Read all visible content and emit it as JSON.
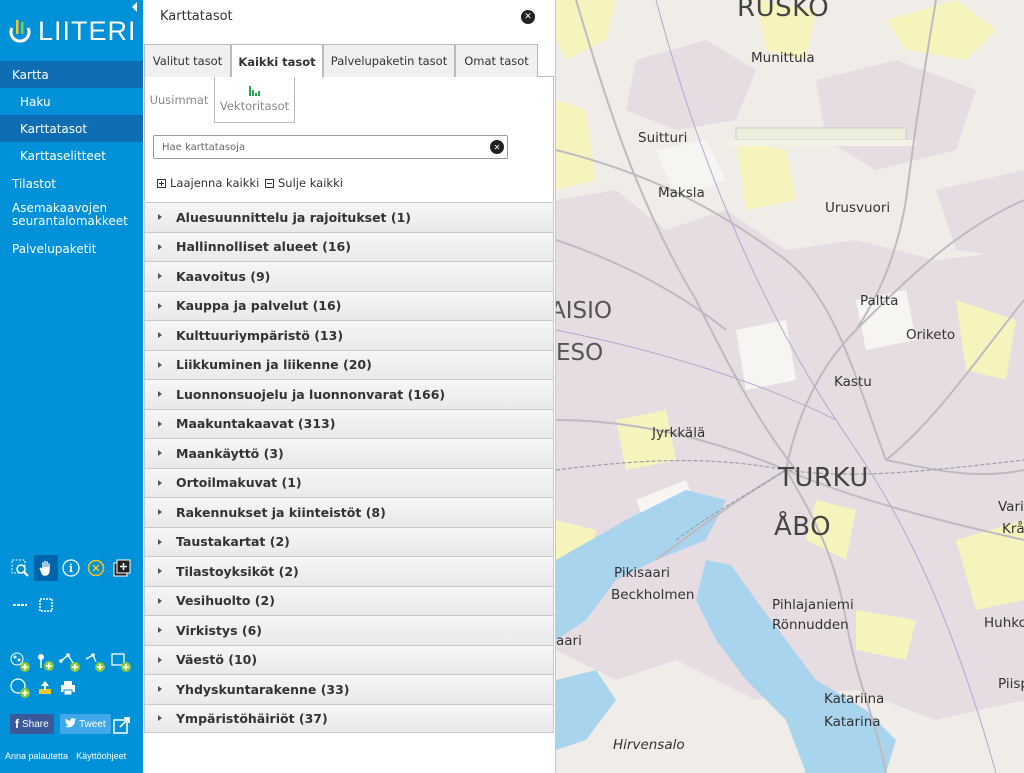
{
  "app": {
    "logo_text": "LIITERI"
  },
  "nav": {
    "kartta": "Kartta",
    "haku": "Haku",
    "karttatasot": "Karttatasot",
    "karttaselitteet": "Karttaselitteet",
    "tilastot": "Tilastot",
    "asemakaavojen": "Asemakaavojen seurantalomakkeet",
    "palvelupaketit": "Palvelupaketit"
  },
  "share": {
    "facebook": "Share",
    "twitter": "Tweet"
  },
  "footer": {
    "feedback": "Anna palautetta",
    "help": "Käyttöohjeet"
  },
  "panel": {
    "title": "Karttatasot",
    "tabs": [
      "Valitut tasot",
      "Kaikki tasot",
      "Palvelupaketin tasot",
      "Omat tasot"
    ],
    "subtabs": [
      "Uusimmat",
      "Vektoritasot"
    ],
    "search_placeholder": "Hae karttatasoja",
    "expand_all": "Laajenna kaikki",
    "collapse_all": "Sulje kaikki",
    "groups": [
      "Aluesuunnittelu ja rajoitukset (1)",
      "Hallinnolliset alueet (16)",
      "Kaavoitus (9)",
      "Kauppa ja palvelut (16)",
      "Kulttuuriympäristö (13)",
      "Liikkuminen ja liikenne (20)",
      "Luonnonsuojelu ja luonnonvarat (166)",
      "Maakuntakaavat (313)",
      "Maankäyttö (3)",
      "Ortoilmakuvat (1)",
      "Rakennukset ja kiinteistöt (8)",
      "Taustakartat (2)",
      "Tilastoyksiköt (2)",
      "Vesihuolto (2)",
      "Virkistys (6)",
      "Väestö (10)",
      "Yhdyskuntarakenne (33)",
      "Ympäristöhäiriöt (37)"
    ]
  },
  "map": {
    "labels": {
      "rusko": "RUSKO",
      "munittula": "Munittula",
      "suitturi": "Suitturi",
      "maksla": "Maksla",
      "urusvuori": "Urusvuori",
      "paltta": "Paltta",
      "oriketo": "Oriketo",
      "kastu": "Kastu",
      "aisio": "AISIO",
      "eso": "ESO",
      "jyrkkala": "Jyrkkälä",
      "turku": "TURKU",
      "abo": "ÅBO",
      "var": "Vari",
      "krak": "Kråk",
      "pikisaari": "Pikisaari",
      "beckholmen": "Beckholmen",
      "pihlajaniemi": "Pihlajaniemi",
      "ronnudden": "Rönnudden",
      "aari": "aari",
      "huhko": "Huhko",
      "katariina": "Katariina",
      "katarina": "Katarina",
      "piispa": "Piispa",
      "hirvensalo": "Hirvensalo"
    }
  },
  "colors": {
    "sidebar": "#0091d8",
    "sidebar_active": "#0f6db3",
    "water": "#a9d4ee",
    "green": "#f5f2b8",
    "urban": "#e6dde3"
  }
}
